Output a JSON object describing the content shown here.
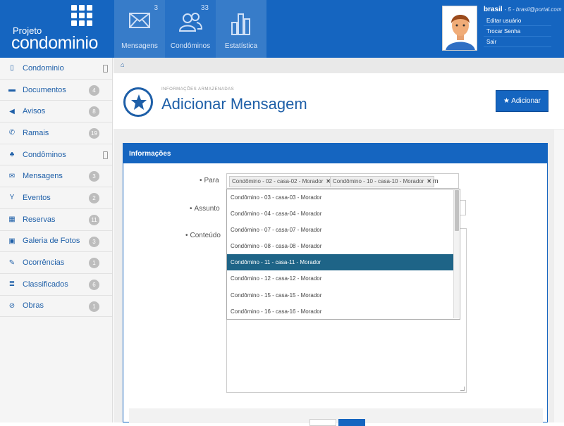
{
  "brand": {
    "line1": "Projeto",
    "line2": "condominio"
  },
  "nav": [
    {
      "label": "Mensagens",
      "count": "3"
    },
    {
      "label": "Condôminos",
      "count": "33"
    },
    {
      "label": "Estatística",
      "count": ""
    }
  ],
  "user": {
    "name": "brasil",
    "detail": "- 5 - brasil@portal.com",
    "menu": [
      "Editar usuário",
      "Trocar Senha",
      "Sair"
    ]
  },
  "sidebar": [
    {
      "icon": "building-icon",
      "glyph": "▯",
      "label": "Condominio",
      "badge": ""
    },
    {
      "icon": "folder-icon",
      "glyph": "▬",
      "label": "Documentos",
      "badge": "4"
    },
    {
      "icon": "megaphone-icon",
      "glyph": "◀",
      "label": "Avisos",
      "badge": "8"
    },
    {
      "icon": "phone-icon",
      "glyph": "✆",
      "label": "Ramais",
      "badge": "19"
    },
    {
      "icon": "users-icon",
      "glyph": "♣",
      "label": "Condôminos",
      "badge": ""
    },
    {
      "icon": "envelope-icon",
      "glyph": "✉",
      "label": "Mensagens",
      "badge": "3"
    },
    {
      "icon": "glass-icon",
      "glyph": "Y",
      "label": "Eventos",
      "badge": "2"
    },
    {
      "icon": "calendar-icon",
      "glyph": "▦",
      "label": "Reservas",
      "badge": "11"
    },
    {
      "icon": "picture-icon",
      "glyph": "▣",
      "label": "Galeria de Fotos",
      "badge": "3"
    },
    {
      "icon": "edit-icon",
      "glyph": "✎",
      "label": "Ocorrências",
      "badge": "1"
    },
    {
      "icon": "list-icon",
      "glyph": "≣",
      "label": "Classificados",
      "badge": "6"
    },
    {
      "icon": "ban-icon",
      "glyph": "⊘",
      "label": "Obras",
      "badge": "1"
    }
  ],
  "page": {
    "subtitle": "INFORMAÇÕES ARMAZENADAS",
    "title": "Adicionar Mensagem",
    "add_button": "Adicionar"
  },
  "panel": {
    "heading": "Informações"
  },
  "form": {
    "para_label": "Para",
    "assunto_label": "Assunto",
    "conteudo_label": "Conteúdo",
    "tags": [
      "Condômino - 02 - casa-02 - Morador",
      "Condômino - 10 - casa-10 - Morador"
    ],
    "typed": "m",
    "options": [
      "Condômino - 03 - casa-03 - Morador",
      "Condômino - 04 - casa-04 - Morador",
      "Condômino - 07 - casa-07 - Morador",
      "Condômino - 08 - casa-08 - Morador",
      "Condômino - 11 - casa-11 - Morador",
      "Condômino - 12 - casa-12 - Morador",
      "Condômino - 15 - casa-15 - Morador",
      "Condômino - 16 - casa-16 - Morador"
    ],
    "selected_option": "Condômino - 11 - casa-11 - Morador"
  },
  "colors": {
    "primary": "#1565c0",
    "selected": "#1e6487",
    "badge": "#bdbdbd"
  }
}
